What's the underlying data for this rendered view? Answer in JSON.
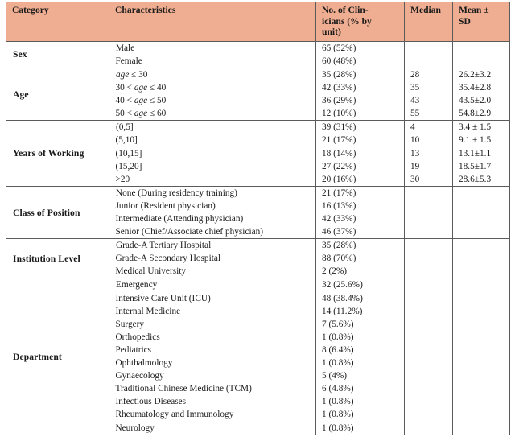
{
  "table": {
    "columns": [
      {
        "key": "category",
        "label": "Category"
      },
      {
        "key": "characteristics",
        "label": "Characteristics"
      },
      {
        "key": "no_clinicians",
        "label_line1": "No. of Clin-",
        "label_line2": "icians (% by",
        "label_line3": "unit)",
        "label": "No. of Clinicians (% by unit)"
      },
      {
        "key": "median",
        "label": "Median"
      },
      {
        "key": "mean_sd",
        "label_line1": "Mean ±",
        "label_line2": "SD",
        "label": "Mean ± SD"
      }
    ],
    "header_background": "#efae91",
    "border_color": "#5b5b5b",
    "sections": [
      {
        "category": "Sex",
        "rows": [
          {
            "characteristic": "Male",
            "no": "65 (52%)",
            "median": "",
            "mean_sd": ""
          },
          {
            "characteristic": "Female",
            "no": "60 (48%)",
            "median": "",
            "mean_sd": ""
          }
        ]
      },
      {
        "category": "Age",
        "rows": [
          {
            "characteristic": "age ≤ 30",
            "char_math": true,
            "no": "35 (28%)",
            "median": "28",
            "mean_sd": "26.2±3.2"
          },
          {
            "characteristic": "30 < age ≤ 40",
            "char_math": true,
            "no": "42 (33%)",
            "median": "35",
            "mean_sd": "35.4±2.8"
          },
          {
            "characteristic": "40 < age ≤ 50",
            "char_math": true,
            "no": "36 (29%)",
            "median": "43",
            "mean_sd": "43.5±2.0"
          },
          {
            "characteristic": "50 < age ≤ 60",
            "char_math": true,
            "no": "12 (10%)",
            "median": "55",
            "mean_sd": "54.8±2.9"
          }
        ]
      },
      {
        "category": "Years of Working",
        "rows": [
          {
            "characteristic": "(0,5]",
            "no": "39 (31%)",
            "median": "4",
            "mean_sd": "3.4 ± 1.5"
          },
          {
            "characteristic": "(5,10]",
            "no": "21 (17%)",
            "median": "10",
            "mean_sd": "9.1 ± 1.5"
          },
          {
            "characteristic": "(10,15]",
            "no": "18 (14%)",
            "median": "13",
            "mean_sd": "13.1±1.1"
          },
          {
            "characteristic": "(15,20]",
            "no": "27 (22%)",
            "median": "19",
            "mean_sd": "18.5±1.7"
          },
          {
            "characteristic": ">20",
            "no": "20 (16%)",
            "median": "30",
            "mean_sd": "28.6±5.3"
          }
        ]
      },
      {
        "category": "Class of Position",
        "rows": [
          {
            "characteristic": "None (During residency training)",
            "no": "21 (17%)",
            "median": "",
            "mean_sd": ""
          },
          {
            "characteristic": "Junior (Resident physician)",
            "no": "16 (13%)",
            "median": "",
            "mean_sd": ""
          },
          {
            "characteristic": "Intermediate (Attending physician)",
            "no": "42 (33%)",
            "median": "",
            "mean_sd": ""
          },
          {
            "characteristic": "Senior (Chief/Associate chief physician)",
            "no": "46 (37%)",
            "median": "",
            "mean_sd": ""
          }
        ]
      },
      {
        "category": "Institution Level",
        "rows": [
          {
            "characteristic": "Grade-A Tertiary Hospital",
            "no": "35 (28%)",
            "median": "",
            "mean_sd": ""
          },
          {
            "characteristic": "Grade-A Secondary Hospital",
            "no": "88 (70%)",
            "median": "",
            "mean_sd": ""
          },
          {
            "characteristic": "Medical University",
            "no": "2 (2%)",
            "median": "",
            "mean_sd": ""
          }
        ]
      },
      {
        "category": "Department",
        "rows": [
          {
            "characteristic": "Emergency",
            "no": "32 (25.6%)",
            "median": "",
            "mean_sd": ""
          },
          {
            "characteristic": "Intensive Care Unit (ICU)",
            "no": "48 (38.4%)",
            "median": "",
            "mean_sd": ""
          },
          {
            "characteristic": "Internal Medicine",
            "no": "14 (11.2%)",
            "median": "",
            "mean_sd": ""
          },
          {
            "characteristic": "Surgery",
            "no": "7 (5.6%)",
            "median": "",
            "mean_sd": ""
          },
          {
            "characteristic": "Orthopedics",
            "no": "1 (0.8%)",
            "median": "",
            "mean_sd": ""
          },
          {
            "characteristic": "Pediatrics",
            "no": "8 (6.4%)",
            "median": "",
            "mean_sd": ""
          },
          {
            "characteristic": "Ophthalmology",
            "no": "1 (0.8%)",
            "median": "",
            "mean_sd": ""
          },
          {
            "characteristic": "Gynaecology",
            "no": "5 (4%)",
            "median": "",
            "mean_sd": ""
          },
          {
            "characteristic": "Traditional Chinese Medicine (TCM)",
            "no": "6 (4.8%)",
            "median": "",
            "mean_sd": ""
          },
          {
            "characteristic": "Infectious Diseases",
            "no": "1 (0.8%)",
            "median": "",
            "mean_sd": ""
          },
          {
            "characteristic": "Rheumatology and Immunology",
            "no": "1 (0.8%)",
            "median": "",
            "mean_sd": ""
          },
          {
            "characteristic": "Neurology",
            "no": "1 (0.8%)",
            "median": "",
            "mean_sd": ""
          }
        ]
      }
    ]
  }
}
